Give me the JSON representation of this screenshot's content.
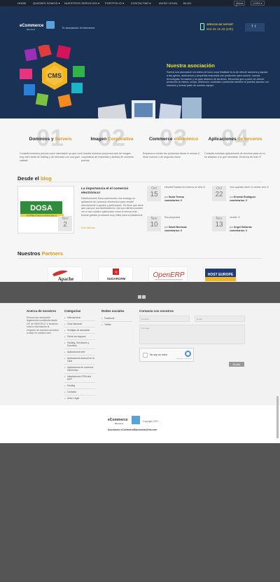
{
  "nav": {
    "items": [
      "HOME",
      "QUIENES SOMOS ▾",
      "NUESTROS SERVICIOS ▾",
      "PORTFOLIO ▾",
      "CONTACTAR ▾",
      "AVISO LEGAL",
      "BLOG"
    ],
    "lang": "Idioma ▾",
    "user": "LOGIN ▾"
  },
  "header": {
    "logo": "eCommerce",
    "logo_sub": "Barcelona",
    "tagline": "Tu asociación eCommerce",
    "phone_label": "SERVICIO DE SOPORT",
    "phone": "615 25 15 33 (24h)"
  },
  "hero": {
    "title": "Nuestra asociación",
    "text": "Somos una asociación sin ánimo de lucro cuya finalidad es la de ofrecer asesoría y ayudar a las pymes, autónomos y pequeñas empresas con productos open-source, nuevas tecnologías, formación y un gran abanico de servicios. Recuerda que a parte de ofrecer productos la misma, ocupa, autónomo, sociedad o particular también le puedes asociar con nosotros y formar parte de nuestro equipo."
  },
  "services": [
    {
      "num": "01",
      "title_a": "Dominios y ",
      "title_b": "Servers",
      "text": "Consulta nuestros precios como asociación ya que con muy bien tarifa de hosting y de mercado con una gran calidad."
    },
    {
      "num": "02",
      "title_a": "Imagen ",
      "title_b": "Corporativa",
      "text": "Consulta nuestros proyectos web de imagen corporativa de empresas y disfruta de nuestros precios."
    },
    {
      "num": "03",
      "title_a": "Commerce ",
      "title_b": "electrónico",
      "text": "Empieza a vender tus productos desde el minuto 0. Sean nuevos o de segunda mano."
    },
    {
      "num": "04",
      "title_a": "Aplicaciones ",
      "title_b": "de terceros",
      "text": "Consulta nuestras aplicaciones de terceros para ver si se adaptan a lo que necesitas. Tenemos de todo !!!"
    }
  ],
  "blog": {
    "heading_a": "Desde el ",
    "heading_b": "blog",
    "featured": {
      "month": "Nov",
      "day": "2",
      "image_text": "DOSA",
      "image_sub": "DISTRIBUCIONES AUTOMOCIÓN S.L",
      "title": "La importancia el el comercio electrónico!",
      "text": "Distribuciones Dosa automoción nos encargo un aplicación de comercio electrónico para vender directamente a pymes y particulares. Se tiene que decir que casi por sus distribuidores. Así sus clientes pueden ver el uso nuestro optimizado como lo hemos más buscar gestión productos muy útiles para la plataforma.",
      "more": "Leer artículo"
    },
    "posts": [
      {
        "month": "Oct",
        "day": "15",
        "title": "Hewlett Packard te reserva un dino !!!",
        "meta_label": "por ",
        "author": "Nuria Tenesa",
        "comments": "comentarios: 0"
      },
      {
        "month": "Oct",
        "day": "22",
        "title": "Your spanish wine? A vender vino !!!",
        "meta_label": "por ",
        "author": "Ernesto Rodríguez",
        "comments": "comentarios: 0"
      },
      {
        "month": "Nov",
        "day": "10",
        "title": "Sus proyectos",
        "meta_label": "por ",
        "author": "David Borrasas",
        "comments": "comentarios: 0"
      },
      {
        "month": "Nov",
        "day": "13",
        "title": "vender !!!",
        "meta_label": "por ",
        "author": "Angel Sollarras",
        "comments": "comentarios: 0"
      }
    ]
  },
  "partners": {
    "heading_a": "Nuestros ",
    "heading_b": "Partners",
    "logos": [
      "Apache",
      "SUGARCRM",
      "OpenERP",
      "HOST EUROPE"
    ]
  },
  "footer": {
    "about_title": "Acerca de nosotros",
    "about_text": "Somos una asociación legalmente constituida desde CIF de 08/07/2017 e tenemos toda la información al respecto de nuestros servicios a estar en nuestra web.",
    "cats_title": "Categorías",
    "cats": [
      "Internacional",
      "Guía Nacional",
      "Ventajas de asociarse",
      "Sobre los equipos",
      "Hosting, Servidores y Dominios",
      "Aplicaciones web",
      "Aplicaciones Android en la nube",
      "Aplicaciones de comercio electrónico",
      "Instalaciones CRM and ERP",
      "Hosting",
      "Contacto",
      "Aviso Legal"
    ],
    "social_title": "Redes sociales",
    "social": [
      "Facebook",
      "Twitter"
    ],
    "contact_title": "Contacta con nosotros",
    "name_ph": "Nombre",
    "email_ph": "Email",
    "msg_ph": "Mensaje",
    "captcha_label": "No soy un robot",
    "captcha_sub": "Privacidad - Condiciones",
    "send": "Enviar"
  },
  "bottom": {
    "logo": "eCommerce",
    "logo_sub": "Barcelona",
    "copyright": "Copyright 2017 -",
    "email": "Asociación eCommerceBarcelona@info.com"
  }
}
